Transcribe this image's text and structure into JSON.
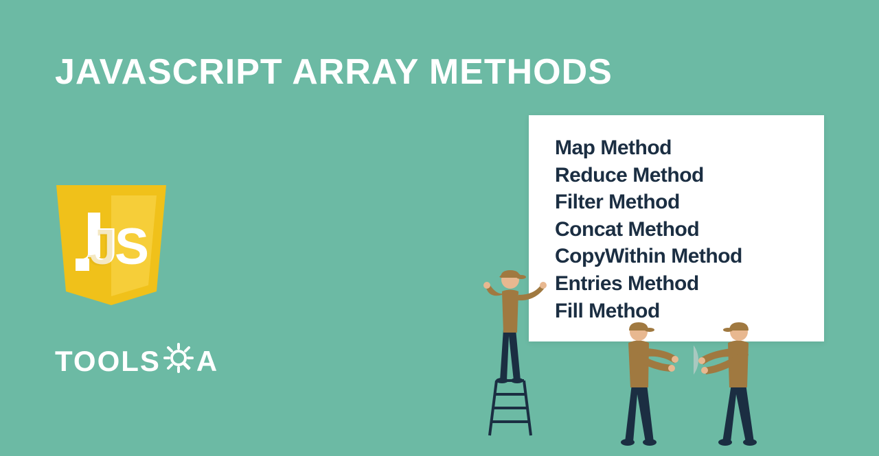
{
  "title": "JAVASCRIPT ARRAY METHODS",
  "brand": {
    "text_tools": "TOOLS",
    "text_a": "A"
  },
  "methods": [
    "Map Method",
    "Reduce Method",
    "Filter Method",
    "Concat Method",
    "CopyWithin Method",
    "Entries Method",
    "Fill Method"
  ],
  "colors": {
    "background": "#6cbaa4",
    "title": "#ffffff",
    "card_bg": "#ffffff",
    "card_text": "#1b2e42",
    "js_logo_bg": "#f0c11a",
    "js_logo_text": "#ffffff",
    "figure_shirt": "#a07940",
    "figure_pants": "#1b2e42",
    "figure_skin": "#e8b890",
    "figure_cap": "#a07940",
    "ladder": "#1b2e42",
    "bulb": "#a8c9c0"
  }
}
